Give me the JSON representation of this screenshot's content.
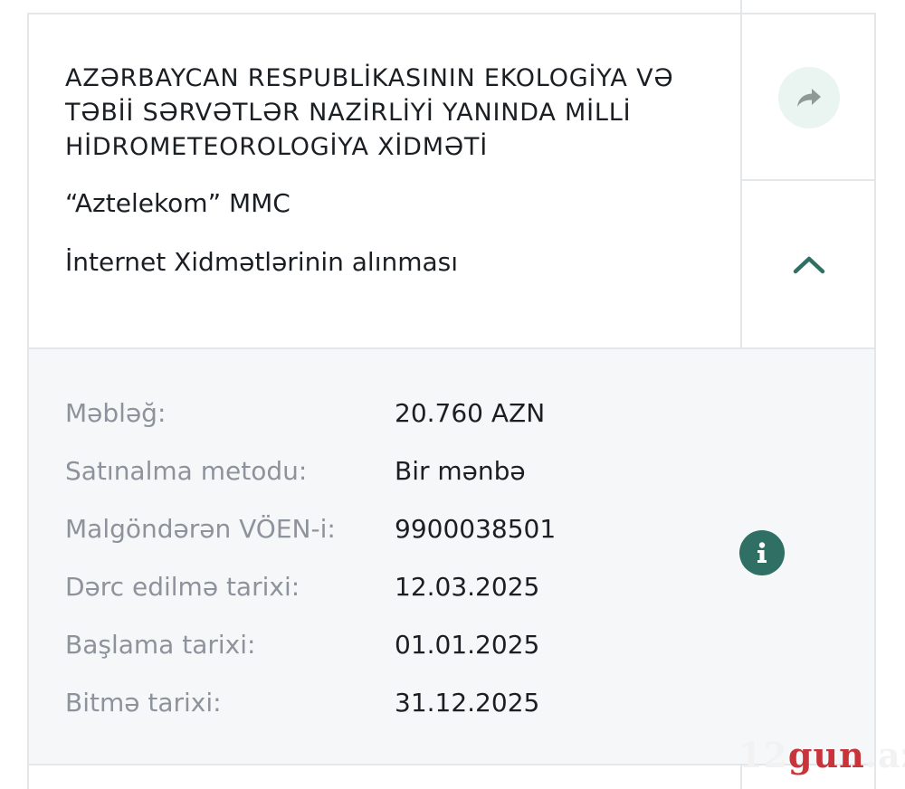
{
  "card": {
    "org_title": "AZƏRBAYCAN RESPUBLİKASININ EKOLOGİYA VƏ TƏBİİ SƏRVƏTLƏR NAZİRLİYİ YANINDA MİLLİ HİDROMETEOROLOGİYA XİDMƏTİ",
    "supplier": "“Aztelekom” MMC",
    "subject": "İnternet Xidmətlərinin alınması",
    "share_icon": "share-forward-icon",
    "collapse_icon": "chevron-up-icon"
  },
  "details": {
    "rows": [
      {
        "label": "Məbləğ:",
        "value": "20.760 AZN"
      },
      {
        "label": "Satınalma metodu:",
        "value": "Bir mənbə"
      },
      {
        "label": "Malgöndərən VÖEN-i:",
        "value": "9900038501"
      },
      {
        "label": "Dərc edilmə tarixi:",
        "value": "12.03.2025"
      },
      {
        "label": "Başlama tarixi:",
        "value": "01.01.2025"
      },
      {
        "label": "Bitmə tarixi:",
        "value": "31.12.2025"
      }
    ],
    "info_icon": "info-icon"
  },
  "watermark": {
    "num": "12",
    "gun": "gun",
    "az": ".az"
  },
  "colors": {
    "accent": "#2f6f64",
    "share_bg": "#eaf4f1",
    "details_bg": "#f6f7f8",
    "label_gray": "#8d939c",
    "text": "#1b1f24",
    "border": "#e4e7ea",
    "watermark_red": "#c8343a"
  }
}
